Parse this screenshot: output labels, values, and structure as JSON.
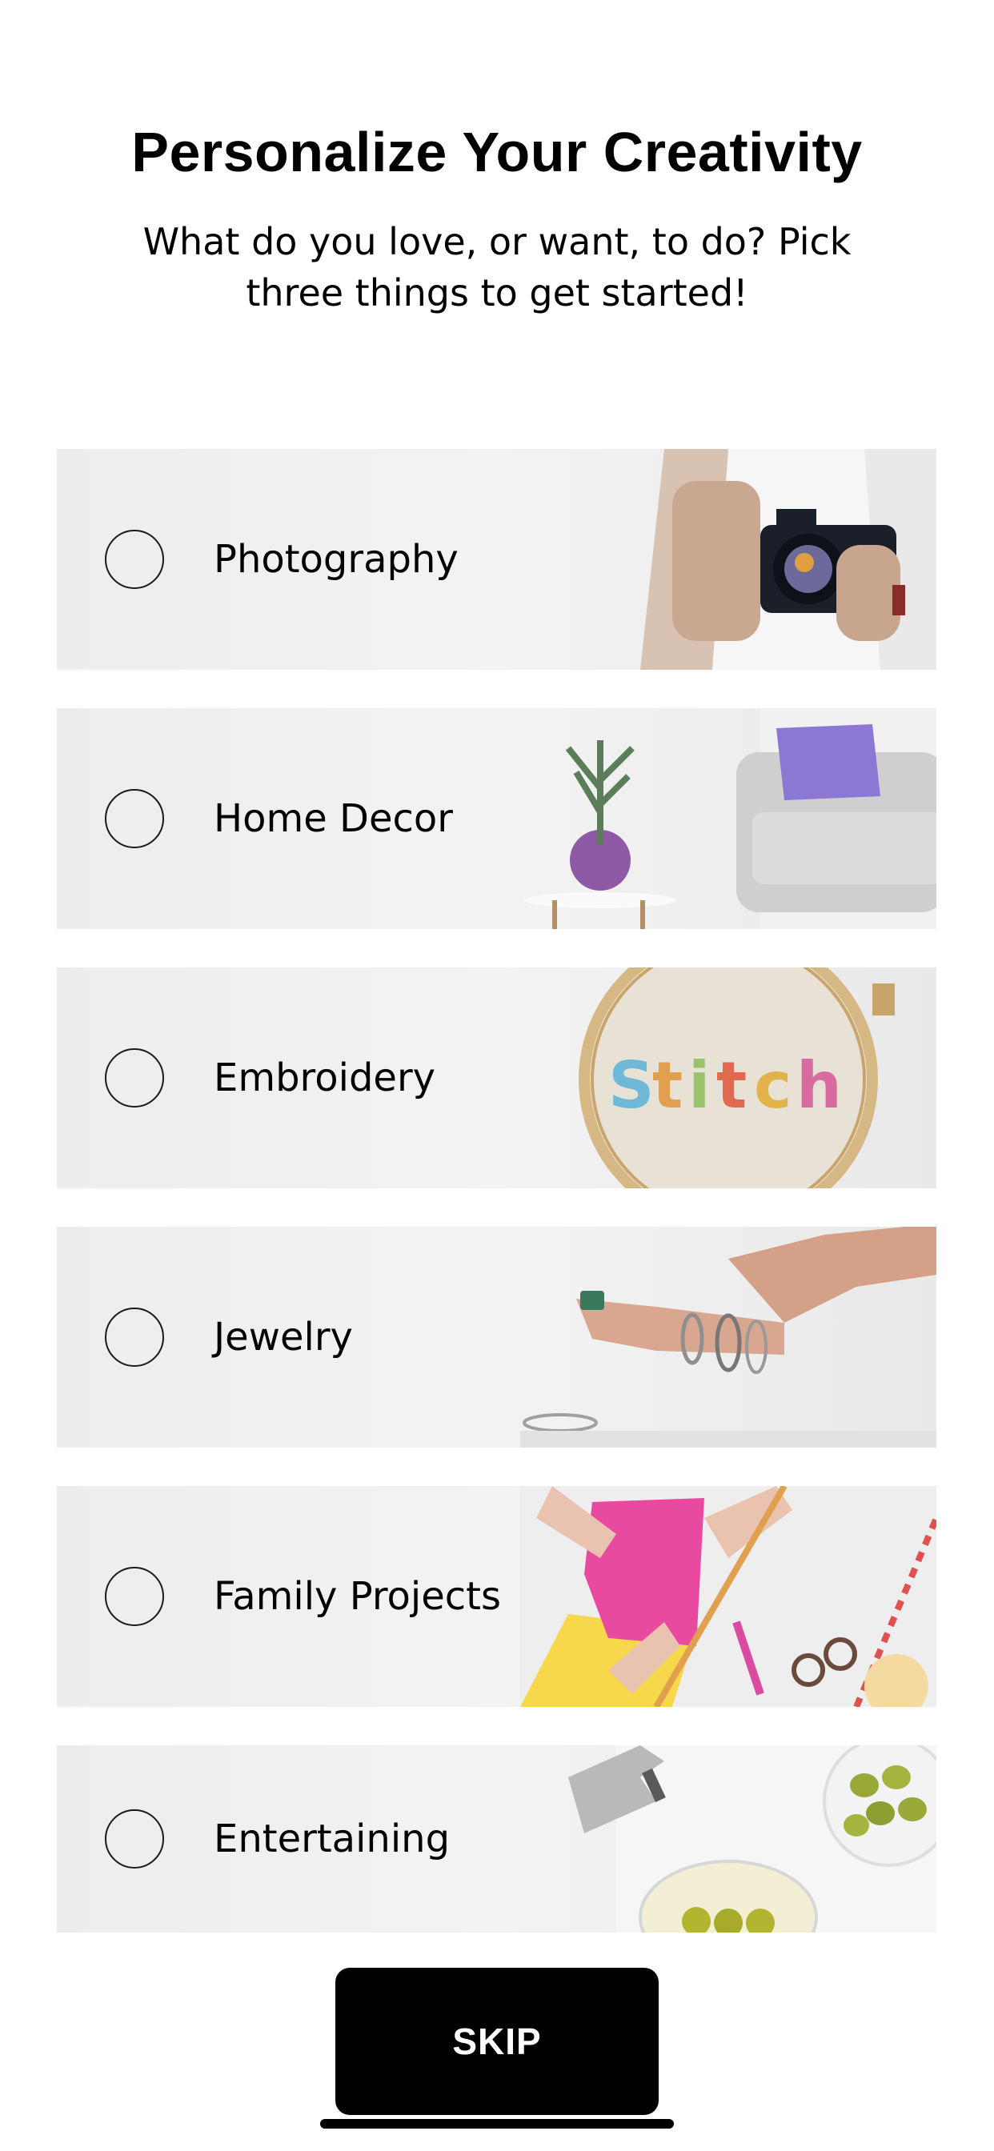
{
  "header": {
    "title": "Personalize Your Creativity",
    "subtitle": "What do you love, or want, to do? Pick three things to get started!"
  },
  "categories": [
    {
      "label": "Photography",
      "image": "camera-photo-icon",
      "selected": false
    },
    {
      "label": "Home Decor",
      "image": "sofa-and-plant-icon",
      "selected": false
    },
    {
      "label": "Embroidery",
      "image": "embroidery-hoop-icon",
      "selected": false
    },
    {
      "label": "Jewelry",
      "image": "bracelet-hands-icon",
      "selected": false
    },
    {
      "label": "Family Projects",
      "image": "paper-craft-icon",
      "selected": false
    },
    {
      "label": "Entertaining",
      "image": "cocktail-olives-icon",
      "selected": false
    }
  ],
  "footer": {
    "skip_label": "SKIP"
  },
  "colors": {
    "background": "#ffffff",
    "card": "#eeeeef",
    "button": "#000000",
    "button_text": "#ffffff"
  }
}
